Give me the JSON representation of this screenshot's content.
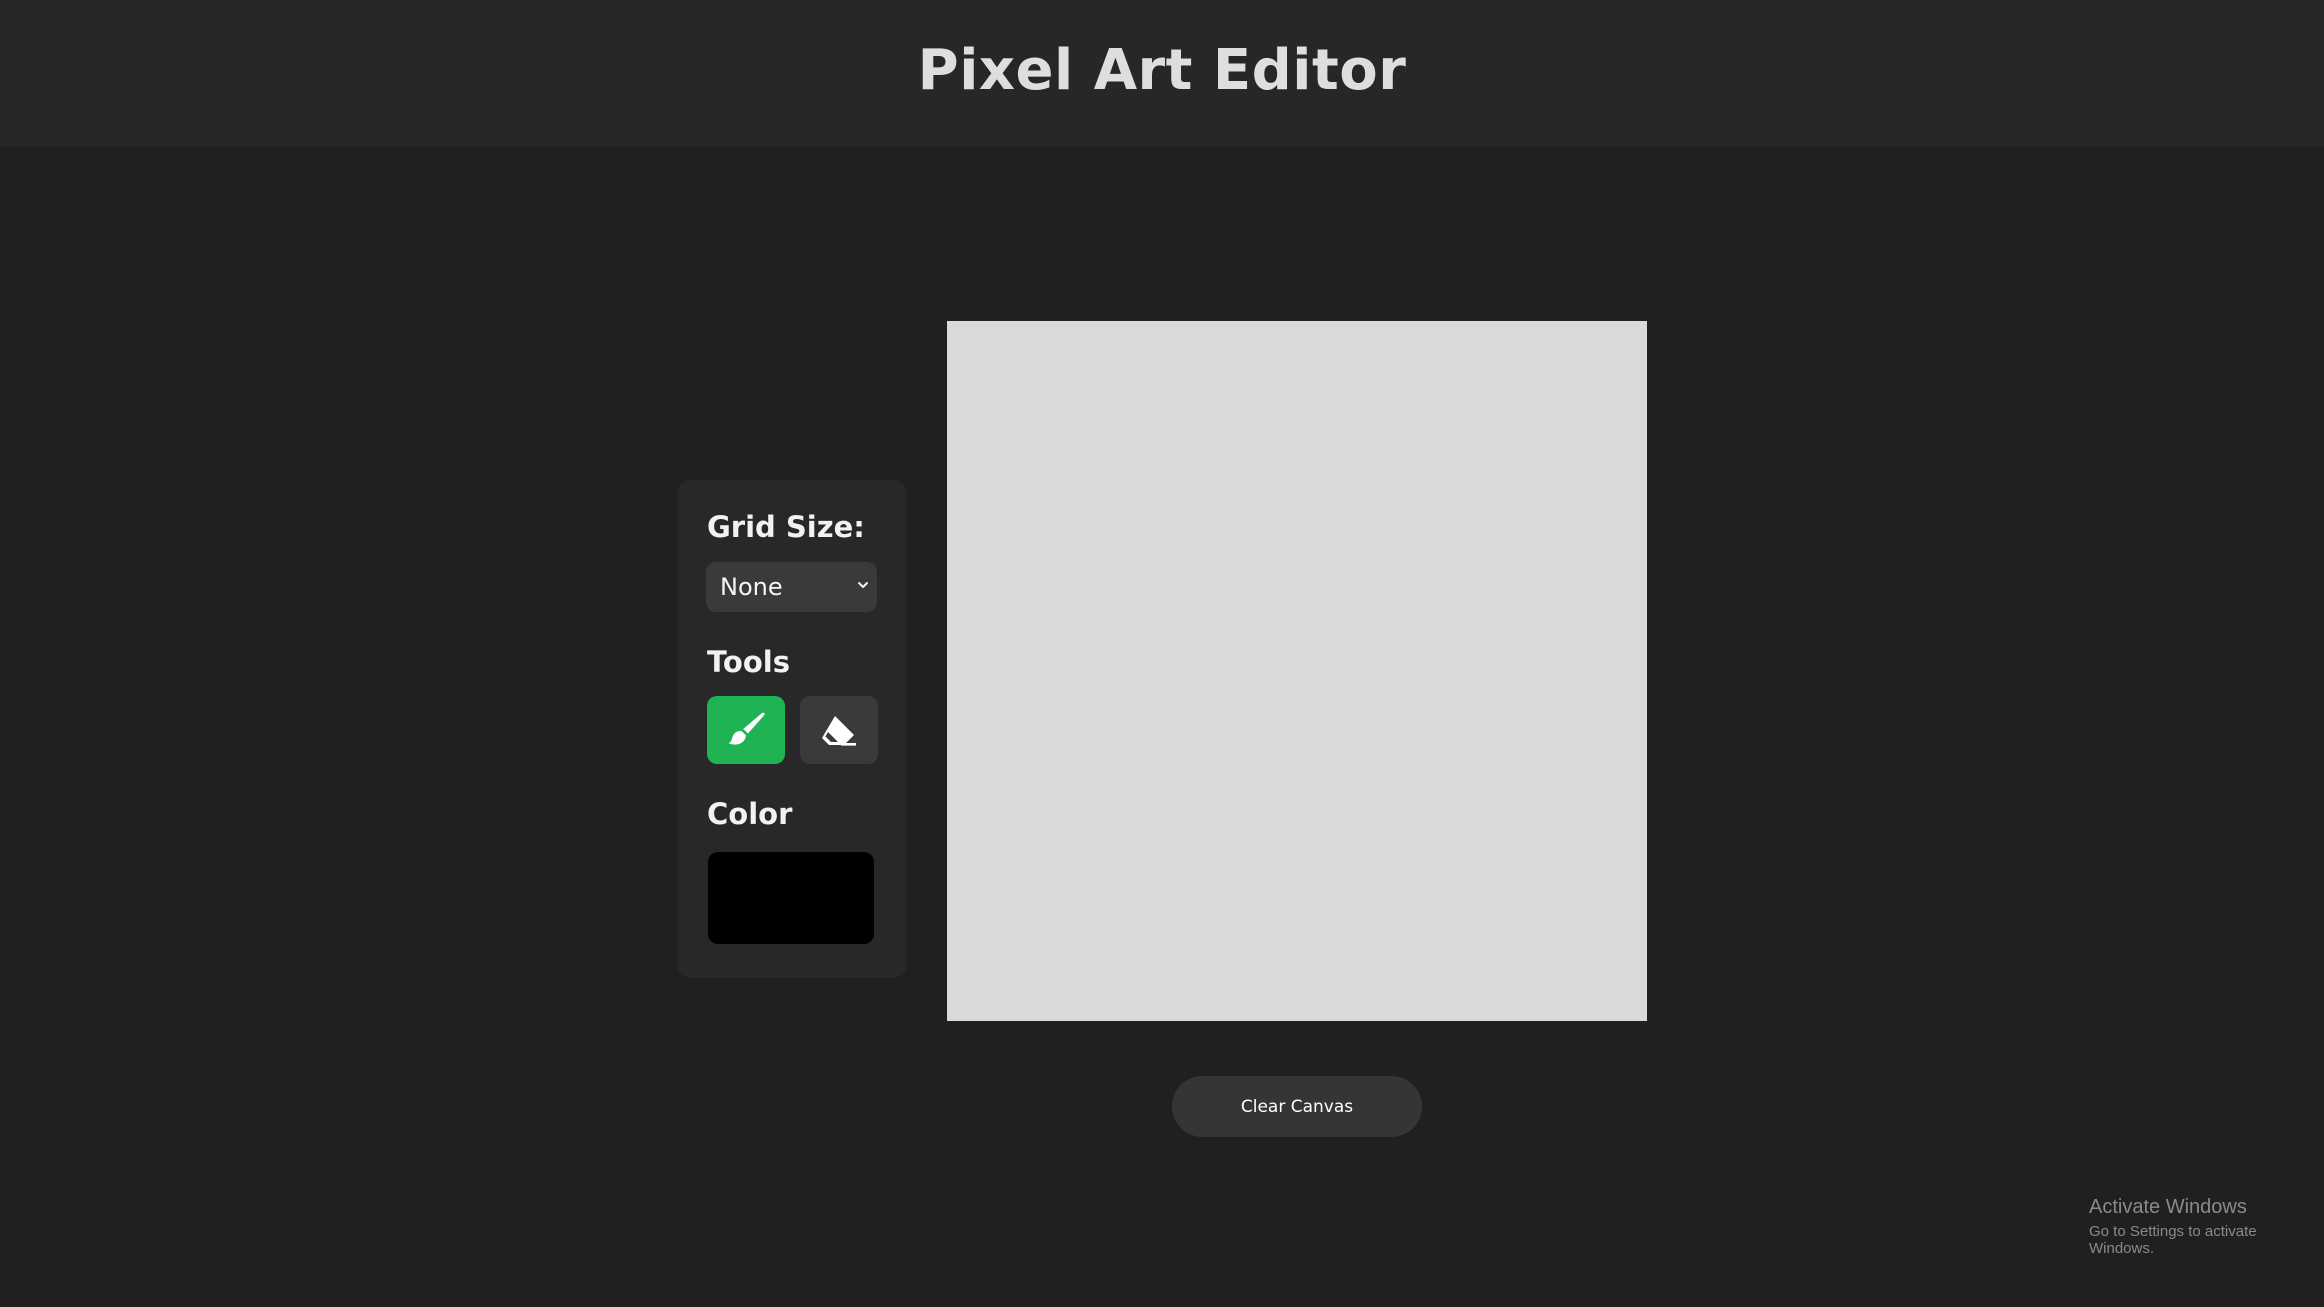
{
  "header": {
    "title": "Pixel Art Editor"
  },
  "sidebar": {
    "grid_size_label": "Grid Size:",
    "grid_size_selected": "None",
    "tools_label": "Tools",
    "tools": [
      {
        "name": "brush",
        "icon": "paintbrush-icon",
        "active": true
      },
      {
        "name": "eraser",
        "icon": "eraser-icon",
        "active": false
      }
    ],
    "color_label": "Color",
    "current_color": "#000000"
  },
  "canvas": {
    "background": "#dadada"
  },
  "actions": {
    "clear_label": "Clear Canvas"
  },
  "colors": {
    "accent": "#1fb354",
    "background": "#202020",
    "header": "#272727",
    "panel": "#282828"
  },
  "watermark": {
    "title": "Activate Windows",
    "subtitle": "Go to Settings to activate Windows."
  }
}
